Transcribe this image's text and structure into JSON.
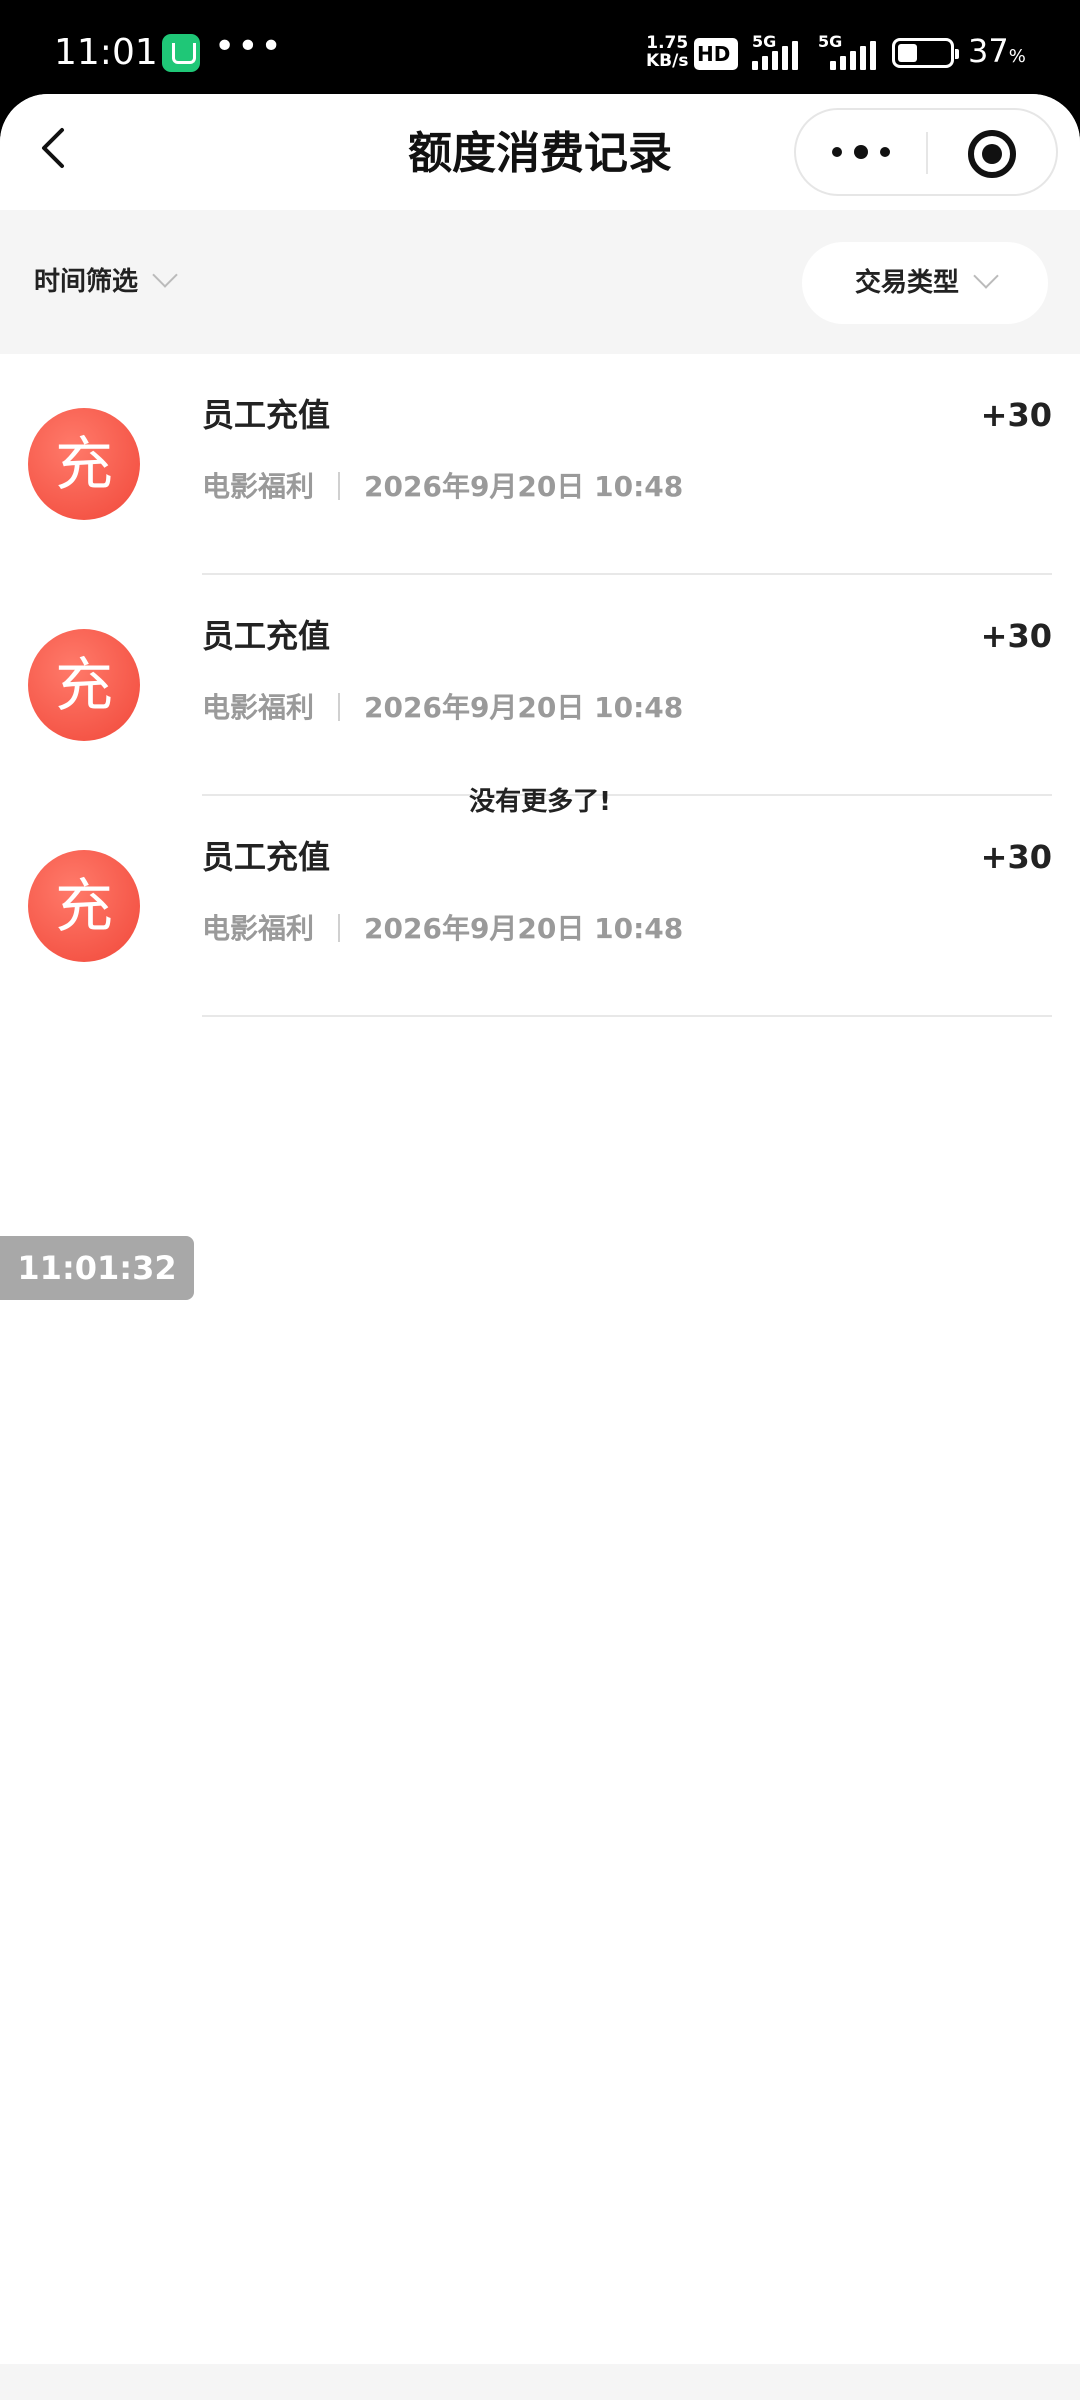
{
  "status_bar": {
    "time": "11:01",
    "dots": "•••",
    "net_speed_value": "1.75",
    "net_speed_unit": "KB/s",
    "hd_label": "HD",
    "sim1_label": "5G",
    "sim2_label": "5G",
    "battery_percent": 37,
    "battery_text": "37",
    "battery_unit": "%"
  },
  "nav": {
    "title": "额度消费记录"
  },
  "filters": {
    "time_label": "时间筛选",
    "type_label": "交易类型"
  },
  "records": [
    {
      "avatar_char": "充",
      "title": "员工充值",
      "category": "电影福利",
      "datetime": "2026年9月20日 10:48",
      "amount": "+30"
    },
    {
      "avatar_char": "充",
      "title": "员工充值",
      "category": "电影福利",
      "datetime": "2026年9月20日 10:48",
      "amount": "+30"
    },
    {
      "avatar_char": "充",
      "title": "员工充值",
      "category": "电影福利",
      "datetime": "2026年9月20日 10:48",
      "amount": "+30"
    }
  ],
  "list_footer": "没有更多了!",
  "overlay_time": "11:01:32",
  "colors": {
    "accent_red": "#f1483a",
    "muted_text": "#9a9a9a",
    "filter_bg": "#f5f5f5"
  }
}
